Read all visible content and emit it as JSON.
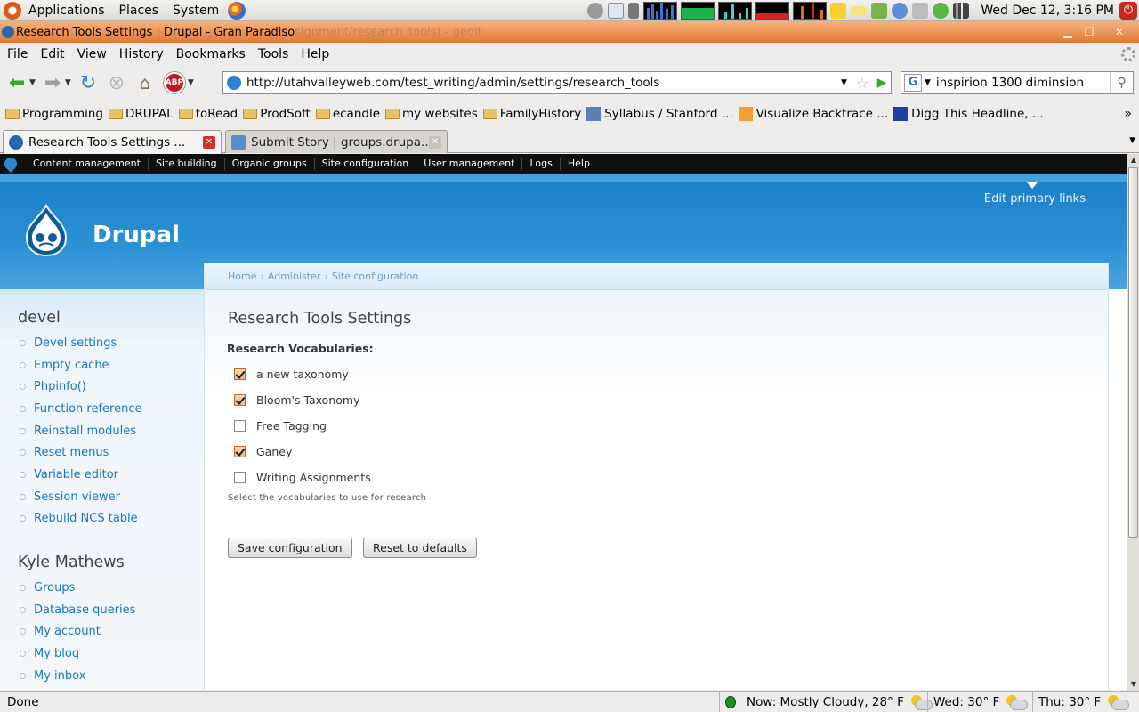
{
  "gnome_panel": {
    "menus": [
      "Applications",
      "Places",
      "System"
    ],
    "clock": "Wed Dec 12,  3:16 PM"
  },
  "window": {
    "title": "Research Tools Settings | Drupal - Gran Paradiso",
    "background_title": "signment/research_tools) - gedit"
  },
  "menubar": [
    "File",
    "Edit",
    "View",
    "History",
    "Bookmarks",
    "Tools",
    "Help"
  ],
  "navbar": {
    "abp_label": "ABP",
    "url": "http://utahvalleyweb.com/test_writing/admin/settings/research_tools",
    "search_engine": "G",
    "search_query": "inspirion 1300 diminsion"
  },
  "bookmarks": [
    {
      "label": "Programming",
      "type": "folder"
    },
    {
      "label": "DRUPAL",
      "type": "folder"
    },
    {
      "label": "toRead",
      "type": "folder"
    },
    {
      "label": "ProdSoft",
      "type": "folder"
    },
    {
      "label": "ecandle",
      "type": "folder"
    },
    {
      "label": "my websites",
      "type": "folder"
    },
    {
      "label": "FamilyHistory",
      "type": "folder"
    },
    {
      "label": "Syllabus / Stanford ...",
      "type": "page"
    },
    {
      "label": "Visualize Backtrace ...",
      "type": "page"
    },
    {
      "label": "Digg This Headline, ...",
      "type": "page"
    }
  ],
  "bookmarks_overflow": "»",
  "tabs": [
    {
      "label": "Research Tools Settings ...",
      "active": true
    },
    {
      "label": "Submit Story | groups.drupa...",
      "active": false
    }
  ],
  "admin_menu": [
    "Content management",
    "Site building",
    "Organic groups",
    "Site configuration",
    "User management",
    "Logs",
    "Help"
  ],
  "site": {
    "name": "Drupal",
    "edit_primary_links": "Edit primary links"
  },
  "sidebar": {
    "blocks": [
      {
        "title": "devel",
        "items": [
          "Devel settings",
          "Empty cache",
          "Phpinfo()",
          "Function reference",
          "Reinstall modules",
          "Reset menus",
          "Variable editor",
          "Session viewer",
          "Rebuild NCS table"
        ]
      },
      {
        "title": "Kyle Mathews",
        "items": [
          "Groups",
          "Database queries",
          "My account",
          "My blog",
          "My inbox"
        ]
      }
    ]
  },
  "breadcrumb": [
    "Home",
    "Administer",
    "Site configuration"
  ],
  "breadcrumb_separator": "›",
  "form": {
    "title": "Research Tools Settings",
    "field_label": "Research Vocabularies:",
    "options": [
      {
        "label": "a new taxonomy",
        "checked": true
      },
      {
        "label": "Bloom's Taxonomy",
        "checked": true
      },
      {
        "label": "Free Tagging",
        "checked": false
      },
      {
        "label": "Ganey",
        "checked": true
      },
      {
        "label": "Writing Assignments",
        "checked": false
      }
    ],
    "description": "Select the vocabularies to use for research",
    "save_label": "Save configuration",
    "reset_label": "Reset to defaults"
  },
  "statusbar": {
    "status": "Done",
    "weather_now": "Now: Mostly Cloudy, 28° F",
    "weather_wed": "Wed: 30° F",
    "weather_thu": "Thu: 30° F"
  },
  "colors": {
    "drupal_blue": "#2b8fd5",
    "link": "#1e74b5",
    "admin_menu_bg": "#101010",
    "checkbox_checked": "#f0b788"
  }
}
